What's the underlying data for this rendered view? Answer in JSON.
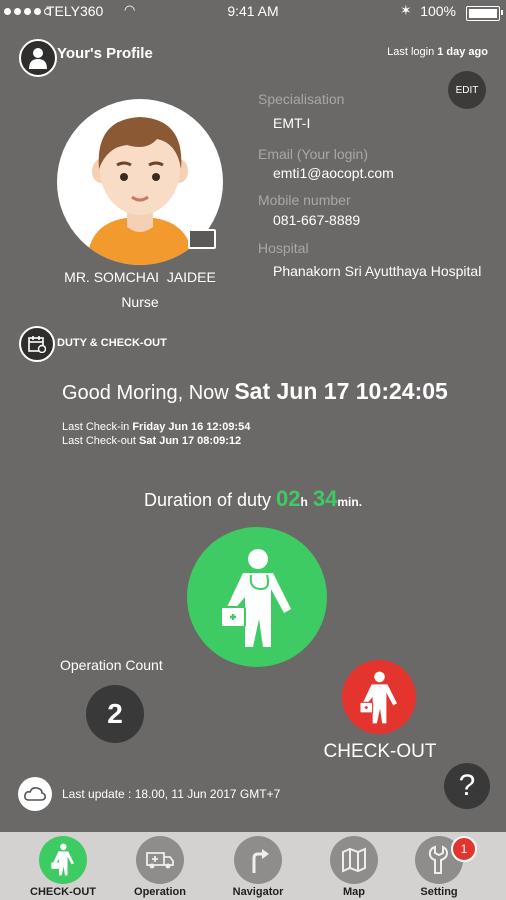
{
  "status_bar": {
    "carrier": "TELY360",
    "time": "9:41 AM",
    "battery": "100%"
  },
  "profile": {
    "title": "Your's Profile",
    "last_login_prefix": "Last login",
    "last_login_value": "1 day ago",
    "edit_label": "EDIT",
    "name": "MR. SOMCHAI  JAIDEE",
    "role": "Nurse",
    "fields": [
      {
        "label": "Specialisation",
        "value": "EMT-I"
      },
      {
        "label": "Email (Your login)",
        "value": "emti1@aocopt.com"
      },
      {
        "label": "Mobile number",
        "value": "081-667-8889"
      },
      {
        "label": "Hospital",
        "value": "Phanakorn Sri Ayutthaya Hospital"
      }
    ]
  },
  "duty": {
    "title": "DUTY & CHECK-OUT",
    "greeting": "Good Moring, Now",
    "now": "Sat Jun 17 10:24:05",
    "last_checkin_label": "Last Check-in",
    "last_checkin_value": "Friday Jun 16 12:09:54",
    "last_checkout_label": "Last Check-out",
    "last_checkout_value": "Sat Jun 17 08:09:12",
    "duration_label": "Duration of duty",
    "hours": "02",
    "hours_unit": "h",
    "minutes": "34",
    "minutes_unit": "min.",
    "operation_count_label": "Operation Count",
    "operation_count": "2",
    "checkout_label": "CHECK-OUT",
    "last_update": "Last update : 18.00, 11 Jun 2017 GMT+7",
    "help": "?"
  },
  "tabs": [
    {
      "label": "CHECK-OUT",
      "icon": "doctor-icon",
      "active": true
    },
    {
      "label": "Operation",
      "icon": "ambulance-icon"
    },
    {
      "label": "Navigator",
      "icon": "navigator-icon"
    },
    {
      "label": "Map",
      "icon": "map-icon"
    },
    {
      "label": "Setting",
      "icon": "wrench-icon",
      "badge": "1"
    }
  ],
  "colors": {
    "background": "#6b6968",
    "green": "#3ecb63",
    "red": "#e4342e",
    "tabbar": "#d4d2d0"
  }
}
